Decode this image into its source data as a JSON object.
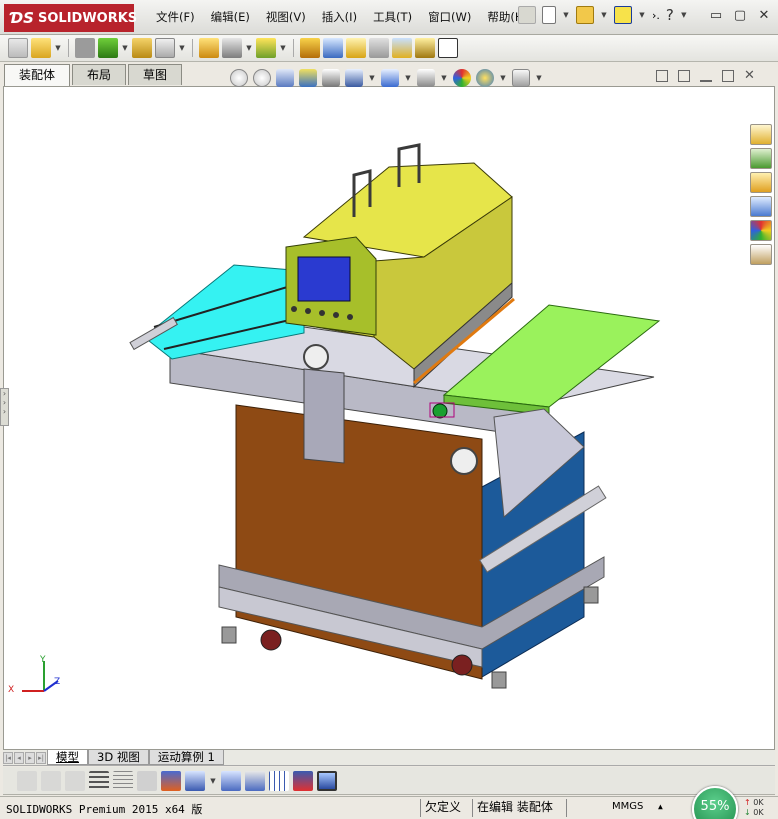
{
  "app": {
    "logo_prefix": "ƊS",
    "logo_text": "SOLIDWORKS",
    "menus": [
      "文件(F)",
      "编辑(E)",
      "视图(V)",
      "插入(I)",
      "工具(T)",
      "窗口(W)",
      "帮助(H)"
    ],
    "menu_overflow": "›.",
    "window_buttons": [
      "▭",
      "▢",
      "✕"
    ]
  },
  "tabs": [
    "装配体",
    "布局",
    "草图"
  ],
  "active_tab": "装配体",
  "bottom_tabs": [
    "模型",
    "3D 视图",
    "运动算例 1"
  ],
  "active_bottom_tab": "模型",
  "triad": {
    "x": "X",
    "y": "Y",
    "z": "Z"
  },
  "status": {
    "product": "SOLIDWORKS Premium 2015 x64 版",
    "state": "欠定义",
    "editing": "在编辑 装配体",
    "units": "MMGS",
    "zoom": "55%",
    "net_up": "0K",
    "net_down": "0K"
  },
  "colors": {
    "accent_red": "#b8232c",
    "machine_yellow": "#e6e54a",
    "machine_cyan": "#35f2f2",
    "machine_green": "#9af25c",
    "machine_brown": "#8e4a14",
    "machine_blue": "#1c5a9a",
    "machine_olive": "#a7bf2a",
    "status_zoom_green": "#2aa35e"
  },
  "icons": {
    "toolbar": [
      "new-doc-icon",
      "open-icon",
      "rebuild-icon",
      "options-icon",
      "help-icon"
    ],
    "task_pane": [
      "home-icon",
      "resources-icon",
      "design-library-icon",
      "file-explorer-icon",
      "appearances-icon",
      "custom-properties-icon"
    ]
  }
}
